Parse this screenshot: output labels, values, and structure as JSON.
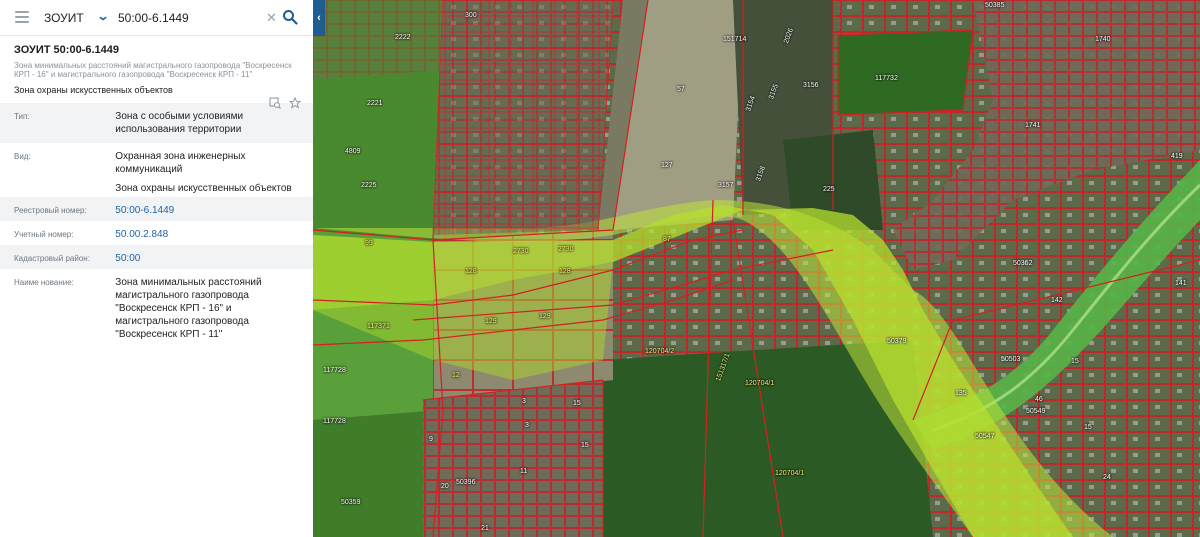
{
  "search": {
    "layer": "ЗОУИТ",
    "value": "50:00-6.1449"
  },
  "object": {
    "title": "ЗОУИТ 50:00-6.1449",
    "subtitle": "Зона минимальных расстояний магистрального газопровода \"Воскресенск КРП - 16\" и магистрального газопровода \"Воскресенск КРП - 11\"",
    "category": "Зона охраны искусственных объектов"
  },
  "attributes": {
    "type": {
      "key": "Тип:",
      "value": "Зона с особыми условиями использования территории"
    },
    "kind": {
      "key": "Вид:",
      "value_1": "Охранная зона инженерных коммуникаций",
      "value_2": "Зона охраны искусственных объектов"
    },
    "registry": {
      "key": "Реестровый номер:",
      "value": "50:00-6.1449"
    },
    "account": {
      "key": "Учетный номер:",
      "value": "50.00.2.848"
    },
    "cadastral": {
      "key": "Кадастровый район:",
      "value": "50:00"
    },
    "name": {
      "key": "Наиме нование:",
      "value": "Зона минимальных расстояний магистрального газопровода \"Воскресенск КРП - 16\" и магистрального газопровода \"Воскресенск КРП - 11\""
    }
  },
  "map": {
    "labels": {
      "l300": "300",
      "l2222": "2222",
      "l151714": "151714",
      "l2026": "2026",
      "l117732": "117732",
      "l3156": "3156",
      "l2221": "2221",
      "l57": "57",
      "l3154": "3154",
      "l3155": "3155",
      "l4809": "4809",
      "l2225": "2225",
      "l127": "127",
      "l3157": "3157",
      "l3158": "3158",
      "l225": "225",
      "l99": "99",
      "l2730a": "2730",
      "l2730b": "2730",
      "l87": "87",
      "l128a": "128",
      "l128b": "128",
      "l129a": "129",
      "l129b": "129",
      "l117371": "117371",
      "l120704_2": "120704/2",
      "l151317": "151317/1",
      "l120704_1a": "120704/1",
      "l120704_1b": "120704/1",
      "l117728a": "117728",
      "l117728b": "117728",
      "l12": "12",
      "l3a": "3",
      "l15a": "15",
      "l3b": "3",
      "l9": "9",
      "l11": "11",
      "l20": "20",
      "l50396": "50396",
      "l50359": "50359",
      "l21": "21",
      "l15b": "15",
      "l50379": "50379",
      "l50503": "50503",
      "l135": "135",
      "l50547": "50547",
      "l50549": "50549",
      "l46": "46",
      "l15c": "15",
      "l24": "24",
      "l142": "142",
      "l141": "141",
      "l419": "419",
      "l50362": "50362",
      "l50385": "50385",
      "l1740": "1740",
      "l1741": "1741"
    }
  }
}
